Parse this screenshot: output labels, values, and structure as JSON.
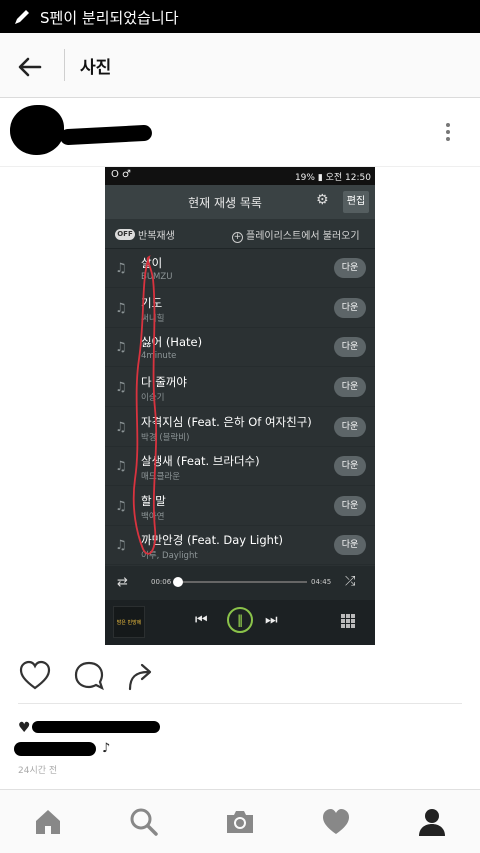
{
  "statusbar": {
    "notification": "S펜이 분리되었습니다"
  },
  "header": {
    "title": "사진"
  },
  "embedded": {
    "status": {
      "left": "O ♂",
      "right": "19% ▮ 오전 12:50"
    },
    "title": "현재 재생 목록",
    "edit_label": "편집",
    "repeat_toggle": "OFF",
    "repeat_label": "반복재생",
    "load_label": "플레이리스트에서 불러오기",
    "download_label": "다운",
    "songs": [
      {
        "title": "살이",
        "artist": "BUMZU"
      },
      {
        "title": "기도",
        "artist": "써니힐"
      },
      {
        "title": "싫어 (Hate)",
        "artist": "4minute"
      },
      {
        "title": "다 줄꺼야",
        "artist": "이승기"
      },
      {
        "title": "자격지심 (Feat. 은하 Of 여자친구)",
        "artist": "박경 (블락비)"
      },
      {
        "title": "살생새 (Feat. 브라더수)",
        "artist": "매드클라운"
      },
      {
        "title": "할 말",
        "artist": "백아연"
      },
      {
        "title": "까만안경 (Feat. Day Light)",
        "artist": "이루, Daylight"
      }
    ],
    "elapsed": "00:06",
    "duration": "04:45",
    "progress": 0.02,
    "album_text": "밤은 빈방에"
  },
  "caption": {
    "text": "♪"
  },
  "time": "24시간 전",
  "colors": {
    "accent_green": "#8bc34a",
    "player_bg": "#2b3133"
  }
}
